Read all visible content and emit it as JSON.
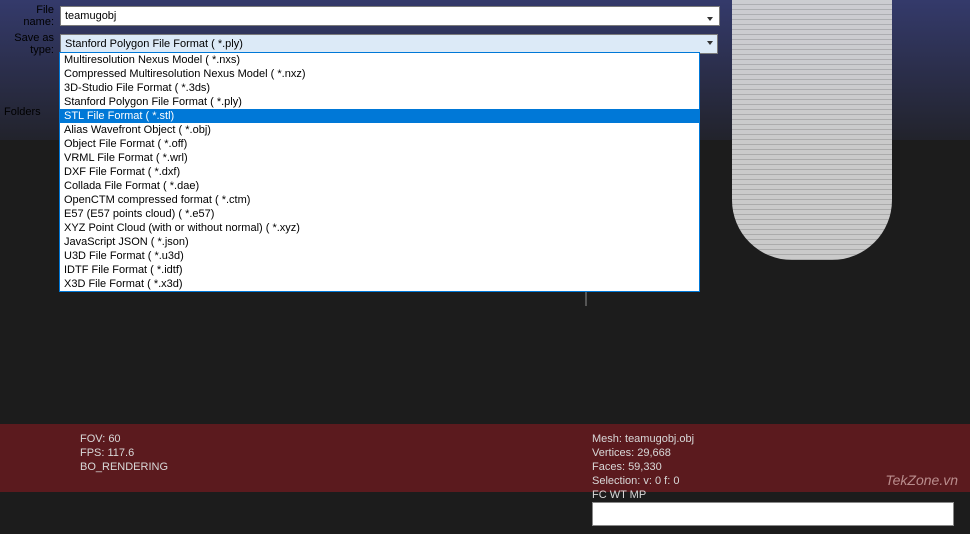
{
  "dialog": {
    "file_name_label": "File name:",
    "file_name_value": "teamugobj",
    "save_as_type_label": "Save as type:",
    "save_as_type_selected": "Stanford Polygon File Format ( *.ply)",
    "folders_label": "Folders",
    "format_options": [
      "Multiresolution Nexus Model ( *.nxs)",
      "Compressed Multiresolution Nexus Model ( *.nxz)",
      "3D-Studio File Format ( *.3ds)",
      "Stanford Polygon File Format ( *.ply)",
      "STL File Format ( *.stl)",
      "Alias Wavefront Object ( *.obj)",
      "Object File Format ( *.off)",
      "VRML File Format ( *.wrl)",
      "DXF File Format ( *.dxf)",
      "Collada File Format ( *.dae)",
      "OpenCTM compressed format ( *.ctm)",
      "E57 (E57 points cloud) ( *.e57)",
      "XYZ Point Cloud (with or without normal) ( *.xyz)",
      "JavaScript JSON ( *.json)",
      "U3D File Format ( *.u3d)",
      "IDTF File Format ( *.idtf)",
      "X3D File Format ( *.x3d)"
    ],
    "highlighted_index": 4
  },
  "status": {
    "left": {
      "fov": "FOV: 60",
      "fps": "FPS:   117.6",
      "mode": "BO_RENDERING"
    },
    "right": {
      "mesh": "Mesh: teamugobj.obj",
      "vertices": "Vertices: 29,668",
      "faces": "Faces: 59,330",
      "selection": "Selection: v: 0 f: 0",
      "fc": "FC WT MP"
    }
  },
  "watermark": "TekZone.vn"
}
